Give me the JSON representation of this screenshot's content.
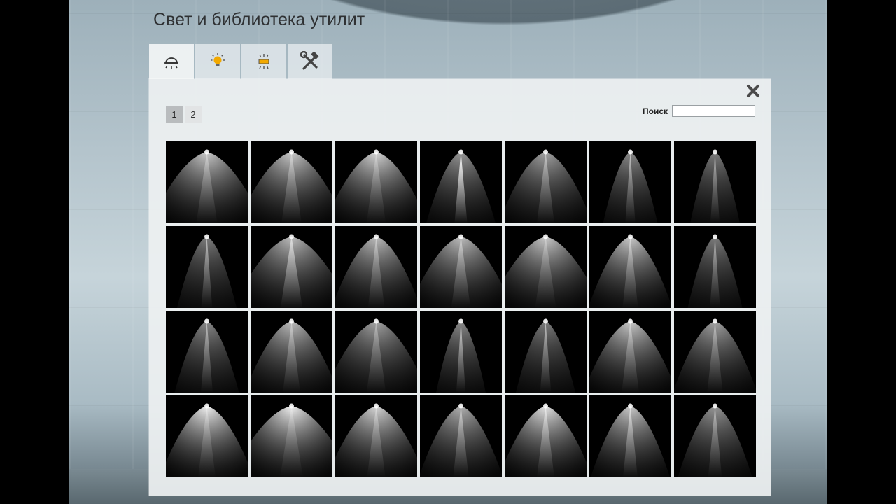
{
  "title": "Свет и библиотека утилит",
  "tabs": [
    {
      "icon": "ceiling-lamp-icon",
      "active": true
    },
    {
      "icon": "bulb-icon",
      "active": false
    },
    {
      "icon": "light-panel-icon",
      "active": false
    },
    {
      "icon": "tools-icon",
      "active": false
    }
  ],
  "pagination": {
    "pages": [
      "1",
      "2"
    ],
    "current": "1"
  },
  "search": {
    "label": "Поиск",
    "value": "",
    "placeholder": ""
  },
  "photometric_thumbnails": [
    {
      "spread": 1.15,
      "intensity": 0.8,
      "beam": 0.35
    },
    {
      "spread": 1.1,
      "intensity": 0.8,
      "beam": 0.4
    },
    {
      "spread": 1.05,
      "intensity": 0.85,
      "beam": 0.3
    },
    {
      "spread": 0.7,
      "intensity": 0.6,
      "beam": 0.95
    },
    {
      "spread": 0.95,
      "intensity": 0.65,
      "beam": 0.45
    },
    {
      "spread": 0.55,
      "intensity": 0.55,
      "beam": 0.55
    },
    {
      "spread": 0.5,
      "intensity": 0.5,
      "beam": 0.5
    },
    {
      "spread": 0.6,
      "intensity": 0.5,
      "beam": 0.55
    },
    {
      "spread": 1.2,
      "intensity": 0.75,
      "beam": 0.6
    },
    {
      "spread": 0.9,
      "intensity": 0.75,
      "beam": 0.4
    },
    {
      "spread": 1.05,
      "intensity": 0.75,
      "beam": 0.45
    },
    {
      "spread": 1.15,
      "intensity": 0.8,
      "beam": 0.3
    },
    {
      "spread": 0.85,
      "intensity": 0.8,
      "beam": 0.45
    },
    {
      "spread": 0.55,
      "intensity": 0.5,
      "beam": 0.5
    },
    {
      "spread": 0.65,
      "intensity": 0.55,
      "beam": 0.5
    },
    {
      "spread": 0.95,
      "intensity": 0.75,
      "beam": 0.4
    },
    {
      "spread": 1.05,
      "intensity": 0.65,
      "beam": 0.35
    },
    {
      "spread": 0.5,
      "intensity": 0.55,
      "beam": 0.65
    },
    {
      "spread": 0.6,
      "intensity": 0.5,
      "beam": 0.55
    },
    {
      "spread": 0.95,
      "intensity": 0.8,
      "beam": 0.4
    },
    {
      "spread": 0.85,
      "intensity": 0.65,
      "beam": 0.4
    },
    {
      "spread": 0.95,
      "intensity": 0.95,
      "beam": 0.3
    },
    {
      "spread": 1.25,
      "intensity": 0.95,
      "beam": 0.25
    },
    {
      "spread": 1.0,
      "intensity": 0.85,
      "beam": 0.35
    },
    {
      "spread": 0.85,
      "intensity": 0.7,
      "beam": 0.5
    },
    {
      "spread": 0.95,
      "intensity": 0.9,
      "beam": 0.5
    },
    {
      "spread": 0.8,
      "intensity": 0.8,
      "beam": 0.55
    },
    {
      "spread": 0.75,
      "intensity": 0.6,
      "beam": 0.45
    }
  ],
  "colors": {
    "panel": "#edf0f1",
    "page_active": "#b9bcbe",
    "thumb_bg": "#000000",
    "title": "#2f3133"
  }
}
